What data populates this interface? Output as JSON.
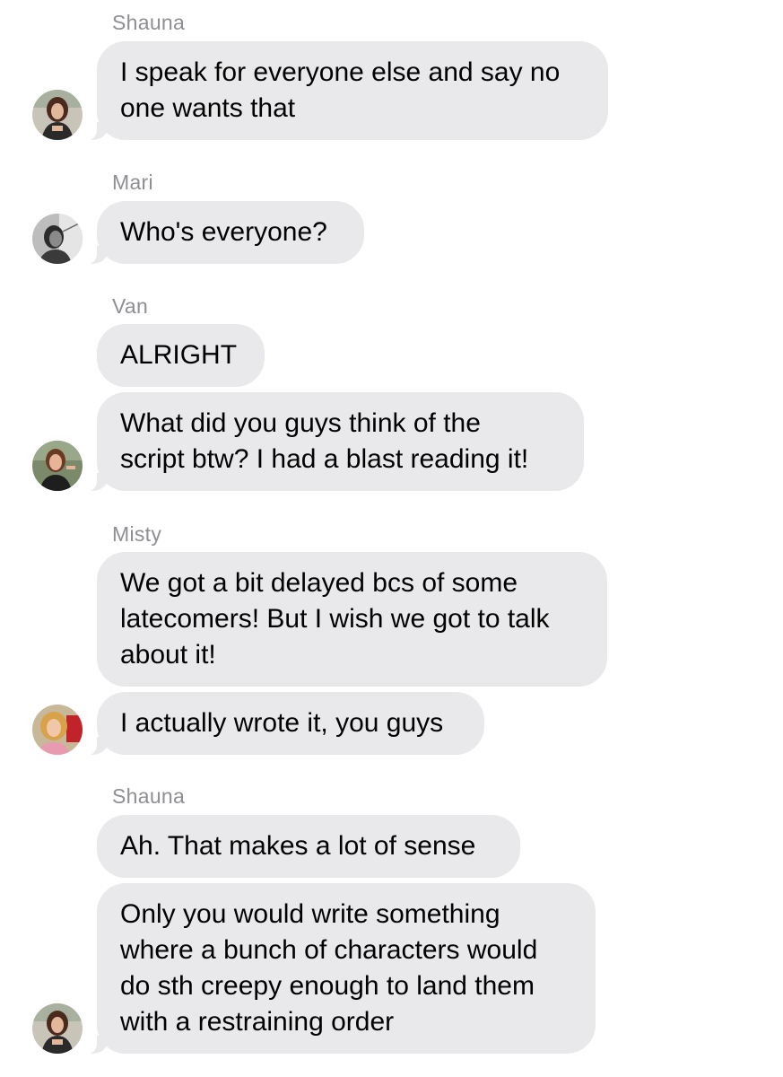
{
  "messages": [
    {
      "sender": "Shauna",
      "text": "I speak for everyone else and say no\none wants that",
      "avatar_icon": "shauna-avatar"
    },
    {
      "sender": "Mari",
      "text": "Who's everyone?",
      "avatar_icon": "mari-avatar"
    },
    {
      "sender": "Van",
      "text": "ALRIGHT"
    },
    {
      "text": "What did you guys think of the\nscript btw? I had a blast reading it!",
      "avatar_icon": "van-avatar"
    },
    {
      "sender": "Misty",
      "text": "We got a bit delayed bcs of some\nlatecomers! But I wish we got to talk\nabout it!"
    },
    {
      "text": "I actually wrote it, you guys",
      "avatar_icon": "misty-avatar"
    },
    {
      "sender": "Shauna",
      "text": "Ah. That makes a lot of sense"
    },
    {
      "text": "Only you would write something\nwhere a bunch of characters would\ndo sth creepy enough to land them\nwith a restraining order",
      "avatar_icon": "shauna-avatar"
    }
  ],
  "colors": {
    "bubble_background": "#e9e9eb",
    "sender_name": "#8e8e93",
    "message_text": "#000000",
    "background": "#ffffff"
  }
}
